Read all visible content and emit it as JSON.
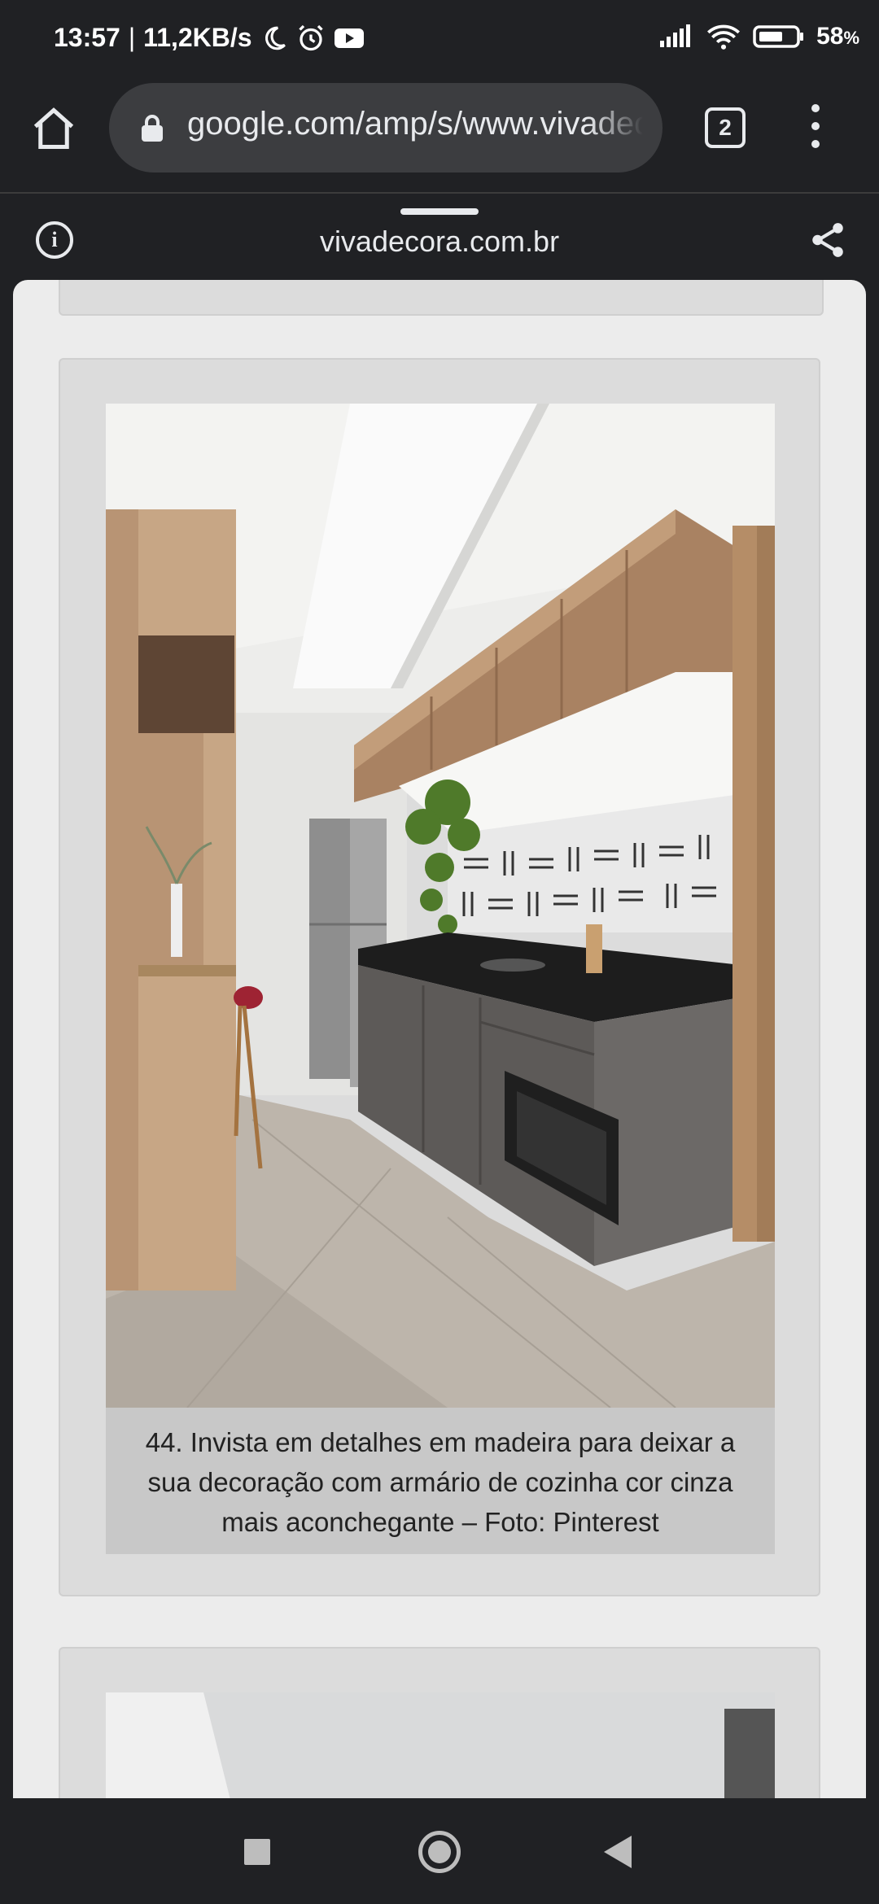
{
  "status_bar": {
    "time": "13:57",
    "speed": "11,2KB/s",
    "battery": "58",
    "battery_unit": "%"
  },
  "browser": {
    "url": "google.com/amp/s/www.vivadecora.com.br",
    "tab_count": "2",
    "domain": "vivadecora.com.br"
  },
  "article": {
    "caption": "44. Invista em detalhes em madeira para deixar a sua decoração com armário de cozinha cor cinza mais aconchegante – Foto: Pinterest"
  },
  "icons": {
    "home": "home-icon",
    "lock": "lock-icon",
    "menu": "more-vert-icon",
    "info": "info-icon",
    "share": "share-icon"
  }
}
